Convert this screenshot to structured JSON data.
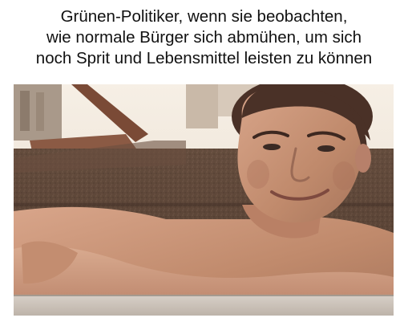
{
  "caption": {
    "lines": [
      "Grünen-Politiker, wenn sie beobachten,",
      "wie normale Bürger sich abmühen, um sich",
      "noch Sprit und Lebensmittel leisten zu können"
    ]
  },
  "photo": {
    "subject": "man-leaning-on-rooftop-ledge-smiling",
    "colors": {
      "sky": "#f4ede2",
      "tar_roof": "#5b4537",
      "skin": "#c58f72",
      "hair": "#4a3127"
    }
  }
}
